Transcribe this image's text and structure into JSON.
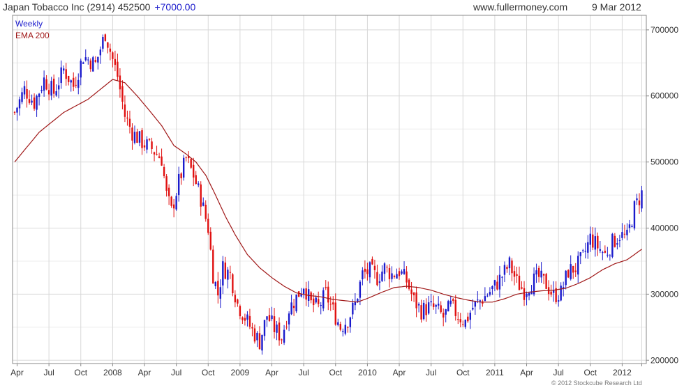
{
  "header": {
    "title": "Japan Tobacco Inc (2914) 452500",
    "change": "+7000.00",
    "site": "www.fullermoney.com",
    "date": "9 Mar 2012"
  },
  "footer": {
    "copyright": "© 2012 Stockcube Research Ltd"
  },
  "colors": {
    "up": "#1a1acc",
    "down": "#e01010",
    "ema": "#a01818",
    "grid": "#d8d8d8",
    "frame": "#888888"
  },
  "chart_data": {
    "type": "candlestick",
    "title": "Japan Tobacco Inc (2914) 452500",
    "legend": [
      "Weekly",
      "EMA 200"
    ],
    "legend_placement": "top-left",
    "yaxis_position": "right",
    "ylim": [
      195000,
      722000
    ],
    "yticks": [
      200000,
      300000,
      400000,
      500000,
      600000,
      700000
    ],
    "grid": true,
    "x_ticks": [
      {
        "label": "Apr",
        "week": 1
      },
      {
        "label": "Jul",
        "week": 14
      },
      {
        "label": "Oct",
        "week": 27
      },
      {
        "label": "2008",
        "week": 40
      },
      {
        "label": "Apr",
        "week": 53
      },
      {
        "label": "Jul",
        "week": 66
      },
      {
        "label": "Oct",
        "week": 79
      },
      {
        "label": "2009",
        "week": 92
      },
      {
        "label": "Apr",
        "week": 105
      },
      {
        "label": "Jul",
        "week": 118
      },
      {
        "label": "Oct",
        "week": 131
      },
      {
        "label": "2010",
        "week": 144
      },
      {
        "label": "Apr",
        "week": 157
      },
      {
        "label": "Jul",
        "week": 170
      },
      {
        "label": "Oct",
        "week": 183
      },
      {
        "label": "2011",
        "week": 196
      },
      {
        "label": "Apr",
        "week": 209
      },
      {
        "label": "Jul",
        "week": 222
      },
      {
        "label": "Oct",
        "week": 235
      },
      {
        "label": "2012",
        "week": 248
      },
      {
        "label": "",
        "week": 256
      }
    ],
    "price_anchors": [
      [
        0,
        575000
      ],
      [
        4,
        610000
      ],
      [
        8,
        590000
      ],
      [
        12,
        625000
      ],
      [
        16,
        605000
      ],
      [
        20,
        640000
      ],
      [
        24,
        615000
      ],
      [
        28,
        660000
      ],
      [
        33,
        648000
      ],
      [
        37,
        695000
      ],
      [
        40,
        655000
      ],
      [
        42,
        630000
      ],
      [
        45,
        570000
      ],
      [
        48,
        545000
      ],
      [
        52,
        530000
      ],
      [
        56,
        520000
      ],
      [
        60,
        505000
      ],
      [
        62,
        450000
      ],
      [
        64,
        425000
      ],
      [
        67,
        470000
      ],
      [
        70,
        505000
      ],
      [
        73,
        480000
      ],
      [
        76,
        445000
      ],
      [
        79,
        400000
      ],
      [
        81,
        330000
      ],
      [
        83,
        300000
      ],
      [
        85,
        340000
      ],
      [
        88,
        330000
      ],
      [
        91,
        285000
      ],
      [
        94,
        265000
      ],
      [
        97,
        245000
      ],
      [
        100,
        228000
      ],
      [
        103,
        268000
      ],
      [
        106,
        248000
      ],
      [
        109,
        235000
      ],
      [
        112,
        278000
      ],
      [
        115,
        295000
      ],
      [
        118,
        315000
      ],
      [
        121,
        285000
      ],
      [
        124,
        280000
      ],
      [
        127,
        300000
      ],
      [
        130,
        275000
      ],
      [
        133,
        250000
      ],
      [
        136,
        262000
      ],
      [
        139,
        285000
      ],
      [
        142,
        330000
      ],
      [
        145,
        335000
      ],
      [
        148,
        325000
      ],
      [
        151,
        340000
      ],
      [
        154,
        330000
      ],
      [
        157,
        335000
      ],
      [
        160,
        320000
      ],
      [
        163,
        290000
      ],
      [
        166,
        275000
      ],
      [
        169,
        280000
      ],
      [
        172,
        278000
      ],
      [
        175,
        265000
      ],
      [
        178,
        282000
      ],
      [
        181,
        268000
      ],
      [
        184,
        258000
      ],
      [
        187,
        280000
      ],
      [
        190,
        290000
      ],
      [
        193,
        300000
      ],
      [
        196,
        312000
      ],
      [
        199,
        328000
      ],
      [
        202,
        345000
      ],
      [
        205,
        318000
      ],
      [
        208,
        305000
      ],
      [
        211,
        318000
      ],
      [
        214,
        325000
      ],
      [
        217,
        315000
      ],
      [
        220,
        298000
      ],
      [
        223,
        302000
      ],
      [
        226,
        335000
      ],
      [
        229,
        340000
      ],
      [
        232,
        355000
      ],
      [
        235,
        385000
      ],
      [
        238,
        372000
      ],
      [
        241,
        360000
      ],
      [
        244,
        378000
      ],
      [
        247,
        390000
      ],
      [
        250,
        385000
      ],
      [
        253,
        430000
      ],
      [
        256,
        452500
      ]
    ],
    "ema_anchors": [
      [
        0,
        500000
      ],
      [
        10,
        545000
      ],
      [
        20,
        575000
      ],
      [
        30,
        595000
      ],
      [
        40,
        625000
      ],
      [
        45,
        620000
      ],
      [
        50,
        600000
      ],
      [
        55,
        578000
      ],
      [
        60,
        555000
      ],
      [
        65,
        525000
      ],
      [
        70,
        512000
      ],
      [
        74,
        500000
      ],
      [
        78,
        480000
      ],
      [
        82,
        450000
      ],
      [
        86,
        418000
      ],
      [
        90,
        390000
      ],
      [
        95,
        360000
      ],
      [
        100,
        340000
      ],
      [
        105,
        325000
      ],
      [
        110,
        312000
      ],
      [
        115,
        302000
      ],
      [
        120,
        298000
      ],
      [
        125,
        296000
      ],
      [
        130,
        292000
      ],
      [
        135,
        290000
      ],
      [
        140,
        288000
      ],
      [
        145,
        295000
      ],
      [
        150,
        303000
      ],
      [
        155,
        310000
      ],
      [
        160,
        312000
      ],
      [
        165,
        310000
      ],
      [
        170,
        306000
      ],
      [
        175,
        300000
      ],
      [
        180,
        295000
      ],
      [
        185,
        291000
      ],
      [
        190,
        288000
      ],
      [
        195,
        288000
      ],
      [
        200,
        293000
      ],
      [
        205,
        300000
      ],
      [
        210,
        303000
      ],
      [
        215,
        305000
      ],
      [
        220,
        306000
      ],
      [
        225,
        309000
      ],
      [
        230,
        316000
      ],
      [
        235,
        325000
      ],
      [
        240,
        337000
      ],
      [
        245,
        346000
      ],
      [
        250,
        352000
      ],
      [
        256,
        368000
      ]
    ]
  }
}
